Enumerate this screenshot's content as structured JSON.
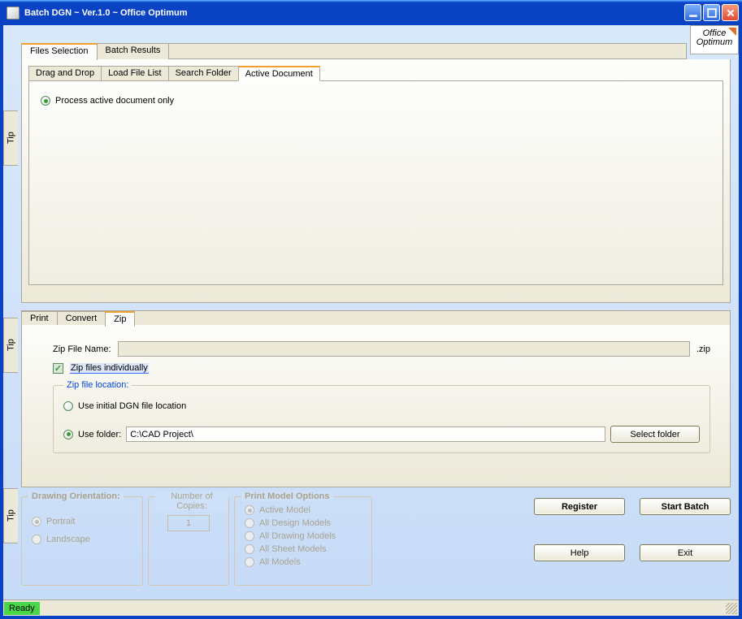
{
  "window": {
    "title": "Batch DGN ~ Ver.1.0 ~ Office Optimum"
  },
  "logo": {
    "line1": "Office",
    "line2": "Optimum"
  },
  "tips": {
    "label": "Tip"
  },
  "mainTabs": {
    "filesSelection": "Files Selection",
    "batchResults": "Batch Results"
  },
  "sourceTabs": {
    "dragDrop": "Drag and Drop",
    "loadFileList": "Load File List",
    "searchFolder": "Search Folder",
    "activeDocument": "Active Document"
  },
  "activeDoc": {
    "processOnly": "Process active document only"
  },
  "outputTabs": {
    "print": "Print",
    "convert": "Convert",
    "zip": "Zip"
  },
  "zip": {
    "fileNameLabel": "Zip File Name:",
    "fileNameValue": "",
    "ext": ".zip",
    "individually": "Zip files individually",
    "locationLegend": "Zip file location:",
    "useInitial": "Use initial DGN file location",
    "useFolder": "Use folder:",
    "folderPath": "C:\\CAD Project\\",
    "selectFolder": "Select folder"
  },
  "orientation": {
    "legend": "Drawing Orientation:",
    "portrait": "Portrait",
    "landscape": "Landscape"
  },
  "copies": {
    "legend": "Number of Copies:",
    "value": "1"
  },
  "printModel": {
    "legend": "Print Model Options",
    "activeModel": "Active Model",
    "allDesign": "All Design Models",
    "allDrawing": "All Drawing Models",
    "allSheet": "All Sheet Models",
    "allModels": "All Models"
  },
  "buttons": {
    "register": "Register",
    "startBatch": "Start Batch",
    "help": "Help",
    "exit": "Exit"
  },
  "status": {
    "ready": "Ready"
  }
}
